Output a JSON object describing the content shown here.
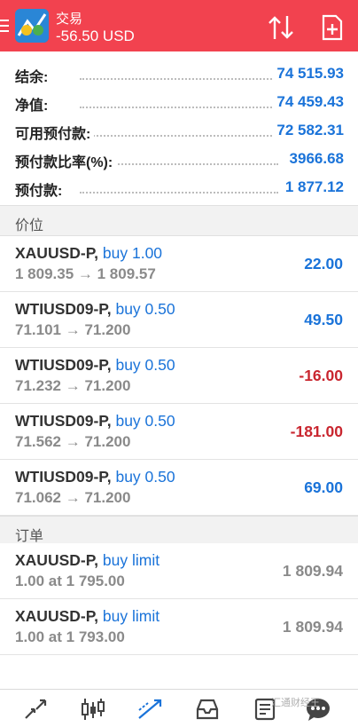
{
  "header": {
    "title": "交易",
    "balance": "-56.50 USD",
    "colors": {
      "background": "#f2424f"
    },
    "icons": [
      "menu-icon",
      "metatrader-logo-icon",
      "sort-icon",
      "new-order-icon"
    ]
  },
  "summary": [
    {
      "label": "结余:",
      "value": "74 515.93"
    },
    {
      "label": "净值:",
      "value": "74 459.43"
    },
    {
      "label": "可用预付款:",
      "value": "72 582.31"
    },
    {
      "label": "预付款比率(%):",
      "value": "3966.68"
    },
    {
      "label": "预付款:",
      "value": "1 877.12"
    }
  ],
  "positions_header": "价位",
  "positions": [
    {
      "symbol": "XAUUSD-P,",
      "side": "buy 1.00",
      "prices": "1 809.35 → 1 809.57",
      "profit": "22.00",
      "sign": "pos"
    },
    {
      "symbol": "WTIUSD09-P,",
      "side": "buy 0.50",
      "prices": "71.101 → 71.200",
      "profit": "49.50",
      "sign": "pos"
    },
    {
      "symbol": "WTIUSD09-P,",
      "side": "buy 0.50",
      "prices": "71.232 → 71.200",
      "profit": "-16.00",
      "sign": "neg"
    },
    {
      "symbol": "WTIUSD09-P,",
      "side": "buy 0.50",
      "prices": "71.562 → 71.200",
      "profit": "-181.00",
      "sign": "neg"
    },
    {
      "symbol": "WTIUSD09-P,",
      "side": "buy 0.50",
      "prices": "71.062 → 71.200",
      "profit": "69.00",
      "sign": "pos"
    }
  ],
  "orders_header": "订单",
  "orders": [
    {
      "symbol": "XAUUSD-P,",
      "side": "buy limit",
      "detail": "1.00 at 1 795.00",
      "price": "1 809.94"
    },
    {
      "symbol": "XAUUSD-P,",
      "side": "buy limit",
      "detail": "1.00 at 1 793.00",
      "price": "1 809.94"
    }
  ],
  "bottom_nav": {
    "items": [
      "quotes-icon",
      "chart-icon",
      "trade-icon",
      "history-icon",
      "news-icon",
      "chat-icon"
    ],
    "watermark": "汇通财经王",
    "active_color": "#1a73d9"
  }
}
